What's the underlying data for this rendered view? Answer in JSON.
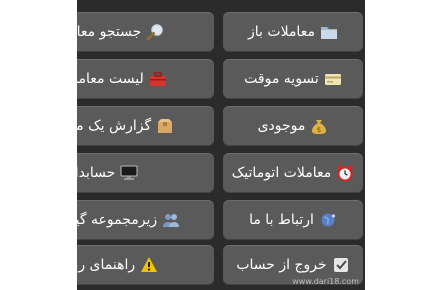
{
  "menu": {
    "buttons": [
      {
        "label": "معاملات باز",
        "icon": "folder-icon",
        "column": "right"
      },
      {
        "label": "جستجو معامله",
        "icon": "magnifier-icon",
        "column": "left"
      },
      {
        "label": "تسویه موقت",
        "icon": "card-icon",
        "column": "right"
      },
      {
        "label": "لیست معاملات",
        "icon": "toolbox-icon",
        "column": "left"
      },
      {
        "label": "موجودی",
        "icon": "money-bag-icon",
        "column": "right"
      },
      {
        "label": "گزارش یک ماهه",
        "icon": "box-icon",
        "column": "left"
      },
      {
        "label": "معاملات اتوماتیک",
        "icon": "alarm-clock-icon",
        "column": "right"
      },
      {
        "label": "حسابداری",
        "icon": "computer-icon",
        "column": "left"
      },
      {
        "label": "ارتباط با ما",
        "icon": "globe-icon",
        "column": "right"
      },
      {
        "label": "زیرمجموعه گیری",
        "icon": "users-icon",
        "column": "left"
      },
      {
        "label": "خروج از حساب",
        "icon": "checkbox-icon",
        "column": "right"
      },
      {
        "label": "راهنمای ربات",
        "icon": "warning-icon",
        "column": "left"
      }
    ]
  },
  "watermark": "www.dari18.com",
  "colors": {
    "background": "#2b2b2b",
    "button": "#5a5a5a",
    "text": "#ffffff"
  }
}
